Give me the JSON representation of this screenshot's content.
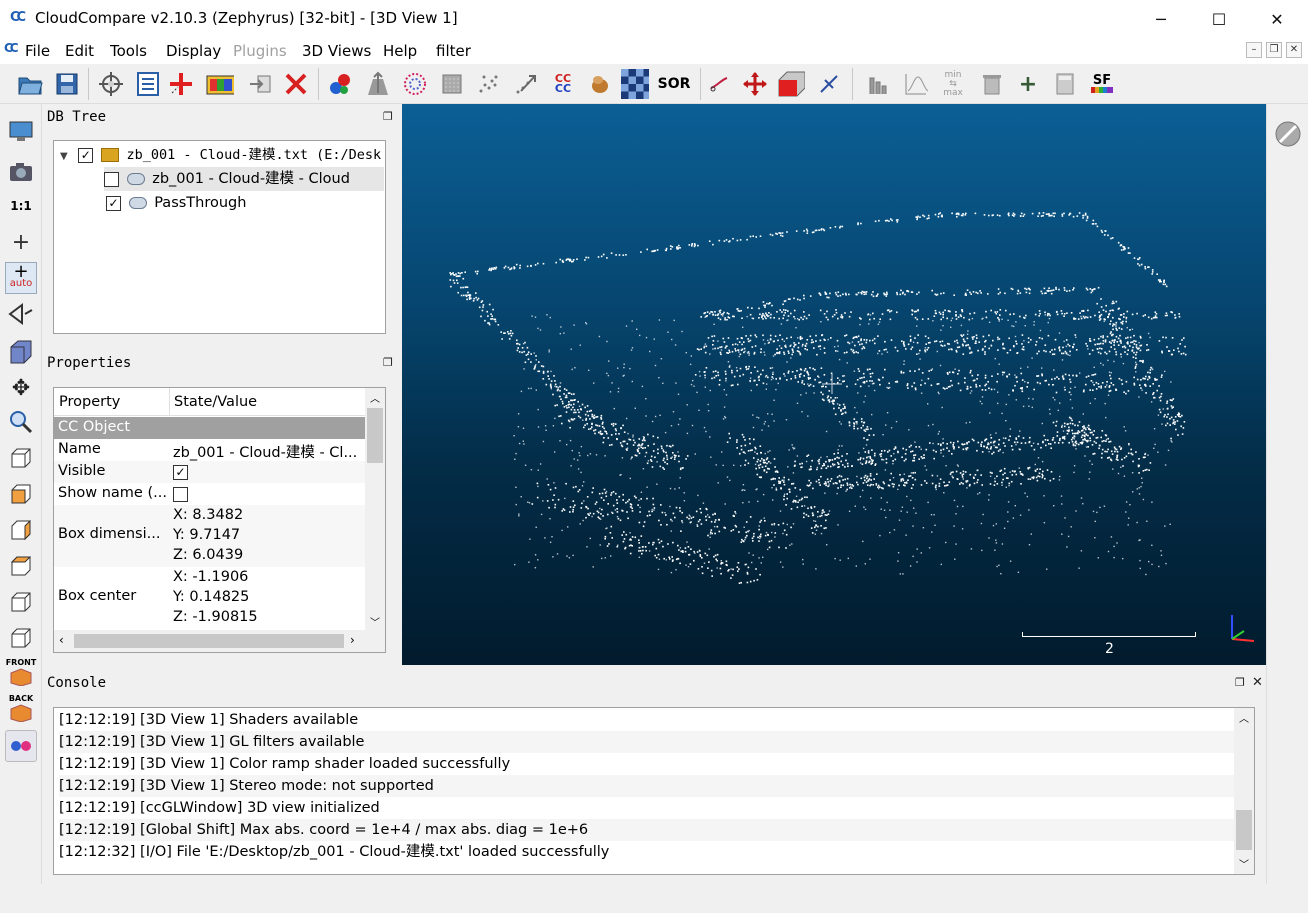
{
  "window": {
    "title": "CloudCompare v2.10.3 (Zephyrus) [32-bit] - [3D View 1]",
    "minimize": "─",
    "maximize": "☐",
    "close": "✕"
  },
  "menubar": {
    "items": [
      {
        "label": "File",
        "enabled": true
      },
      {
        "label": "Edit",
        "enabled": true
      },
      {
        "label": "Tools",
        "enabled": true
      },
      {
        "label": "Display",
        "enabled": true
      },
      {
        "label": "Plugins",
        "enabled": false
      },
      {
        "label": "3D Views",
        "enabled": true
      },
      {
        "label": "Help",
        "enabled": true
      },
      {
        "label": "filter",
        "enabled": true
      }
    ]
  },
  "toolbar_icons": [
    "open-icon",
    "save-icon",
    "pick-point-icon",
    "list-icon",
    "add-icon",
    "color-ramp-icon",
    "export-icon",
    "delete-icon",
    "merge-icon",
    "normals-icon",
    "sample-icon",
    "subsample-icon",
    "noise-icon",
    "registration-icon",
    "cc-icon",
    "octree-icon",
    "checker-icon",
    "sor-filter-icon",
    "cut-icon",
    "translate-icon",
    "box-icon",
    "segment-icon",
    "histogram-icon",
    "statistics-icon",
    "minmax-icon",
    "trash-icon",
    "plus-icon",
    "calculator-icon",
    "scalar-field-icon"
  ],
  "left_toolbar": {
    "one_to_one": "1:1",
    "auto": "auto",
    "front": "FRONT",
    "back": "BACK"
  },
  "db_tree": {
    "title": "DB Tree",
    "items": [
      {
        "label": "zb_001 - Cloud-建模.txt (E:/Desk",
        "checked": true,
        "level": 0,
        "icon": "folder-icon"
      },
      {
        "label": "zb_001 - Cloud-建模 - Cloud",
        "checked": false,
        "level": 1,
        "icon": "cloud-icon",
        "selected": true
      },
      {
        "label": "PassThrough",
        "checked": true,
        "level": 1,
        "icon": "cloud-icon"
      }
    ]
  },
  "properties": {
    "title": "Properties",
    "col_property": "Property",
    "col_value": "State/Value",
    "section": "CC Object",
    "rows": {
      "name_key": "Name",
      "name_val": "zb_001 - Cloud-建模 - Cl...",
      "visible_key": "Visible",
      "visible_checked": true,
      "showname_key": "Show name (...",
      "showname_checked": false,
      "boxdim_key": "Box dimensi...",
      "boxdim_x": "X: 8.3482",
      "boxdim_y": "Y: 9.7147",
      "boxdim_z": "Z: 6.0439",
      "boxcenter_key": "Box center",
      "boxcenter_x": "X: -1.1906",
      "boxcenter_y": "Y: 0.14825",
      "boxcenter_z": "Z: -1.90815"
    }
  },
  "view3d": {
    "scale_label": "2"
  },
  "console": {
    "title": "Console",
    "lines": [
      "[12:12:19] [3D View 1] Shaders available",
      "[12:12:19] [3D View 1] GL filters available",
      "[12:12:19] [3D View 1] Color ramp shader loaded successfully",
      "[12:12:19] [3D View 1] Stereo mode: not supported",
      "[12:12:19] [ccGLWindow] 3D view initialized",
      "[12:12:19] [Global Shift] Max abs. coord = 1e+4 / max abs. diag = 1e+6",
      "[12:12:32] [I/O] File 'E:/Desktop/zb_001 - Cloud-建模.txt' loaded successfully"
    ]
  }
}
